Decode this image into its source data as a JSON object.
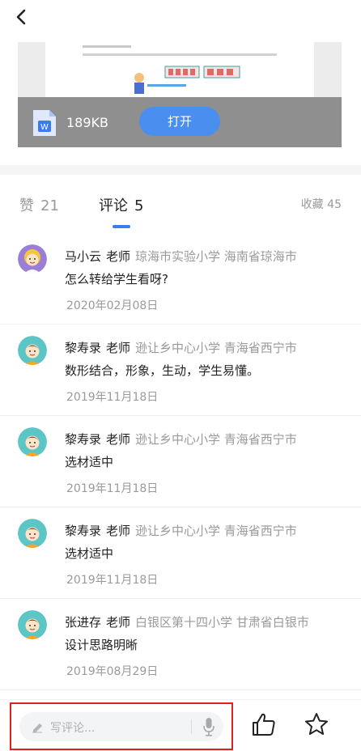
{
  "header": {
    "back_icon": "back-arrow-icon"
  },
  "document": {
    "file_size": "189KB",
    "open_label": "打开",
    "file_icon": "word-file-icon"
  },
  "tabs": {
    "likes": {
      "label": "赞",
      "count": "21"
    },
    "comments": {
      "label": "评论",
      "count": "5"
    },
    "favorites": "收藏 45",
    "accent": "#3a7bf0"
  },
  "comments": [
    {
      "name": "马小云",
      "role": "老师",
      "meta": "琼海市实验小学 海南省琼海市",
      "text": "怎么转给学生看呀?",
      "date": "2020年02月08日"
    },
    {
      "name": "黎寿录",
      "role": "老师",
      "meta": "逊让乡中心小学 青海省西宁市",
      "text": "数形结合，形象，生动，学生易懂。",
      "date": "2019年11月18日"
    },
    {
      "name": "黎寿录",
      "role": "老师",
      "meta": "逊让乡中心小学 青海省西宁市",
      "text": "选材适中",
      "date": "2019年11月18日"
    },
    {
      "name": "黎寿录",
      "role": "老师",
      "meta": "逊让乡中心小学 青海省西宁市",
      "text": "选材适中",
      "date": "2019年11月18日"
    },
    {
      "name": "张进存",
      "role": "老师",
      "meta": "白银区第十四小学 甘肃省白银市",
      "text": "设计思路明晰",
      "date": "2019年08月29日"
    }
  ],
  "bottom": {
    "placeholder": "写评论...",
    "icons": [
      "pencil-icon",
      "microphone-icon",
      "thumbs-up-icon",
      "star-icon"
    ]
  }
}
